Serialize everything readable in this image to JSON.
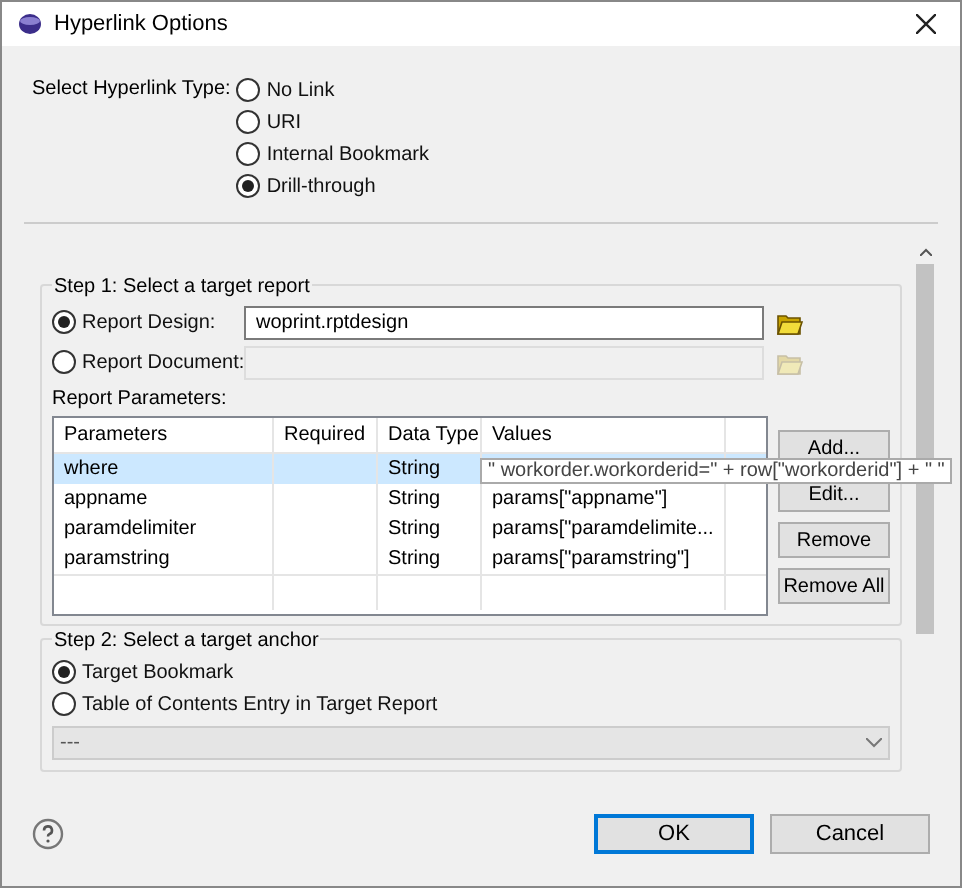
{
  "window": {
    "title": "Hyperlink Options"
  },
  "hyperlink_type": {
    "label": "Select Hyperlink Type:",
    "options": [
      {
        "label": "No Link",
        "selected": false
      },
      {
        "label": "URI",
        "selected": false
      },
      {
        "label": "Internal Bookmark",
        "selected": false
      },
      {
        "label": "Drill-through",
        "selected": true
      }
    ]
  },
  "step1": {
    "title": "Step 1: Select a target report",
    "sources": [
      {
        "label": "Report Design:",
        "selected": true,
        "value": "woprint.rptdesign",
        "disabled": false
      },
      {
        "label": "Report Document:",
        "selected": false,
        "disabled": true
      }
    ],
    "params_label": "Report Parameters:",
    "table": {
      "columns": [
        "Parameters",
        "Required",
        "Data Type",
        "Values"
      ],
      "rows": [
        {
          "cells": [
            "where",
            "",
            "String"
          ],
          "selected": true
        },
        {
          "cells": [
            "appname",
            "",
            "String",
            "params[\"appname\"]"
          ],
          "selected": false
        },
        {
          "cells": [
            "paramdelimiter",
            "",
            "String",
            "params[\"paramdelimite..."
          ],
          "selected": false
        },
        {
          "cells": [
            "paramstring",
            "",
            "String",
            "params[\"paramstring\"]"
          ],
          "selected": false
        }
      ]
    },
    "buttons": [
      "Add...",
      "Edit...",
      "Remove",
      "Remove All"
    ],
    "tooltip": "\" workorder.workorderid=\" + row[\"workorderid\"] + \" \""
  },
  "step2": {
    "title": "Step 2: Select a target anchor",
    "options": [
      {
        "label": "Target Bookmark",
        "selected": true
      },
      {
        "label": "Table of Contents Entry in Target Report",
        "selected": false
      }
    ],
    "dropdown": {
      "value": "---"
    }
  },
  "footer": {
    "buttons": [
      {
        "label": "OK",
        "default": true
      },
      {
        "label": "Cancel",
        "default": false
      }
    ]
  }
}
